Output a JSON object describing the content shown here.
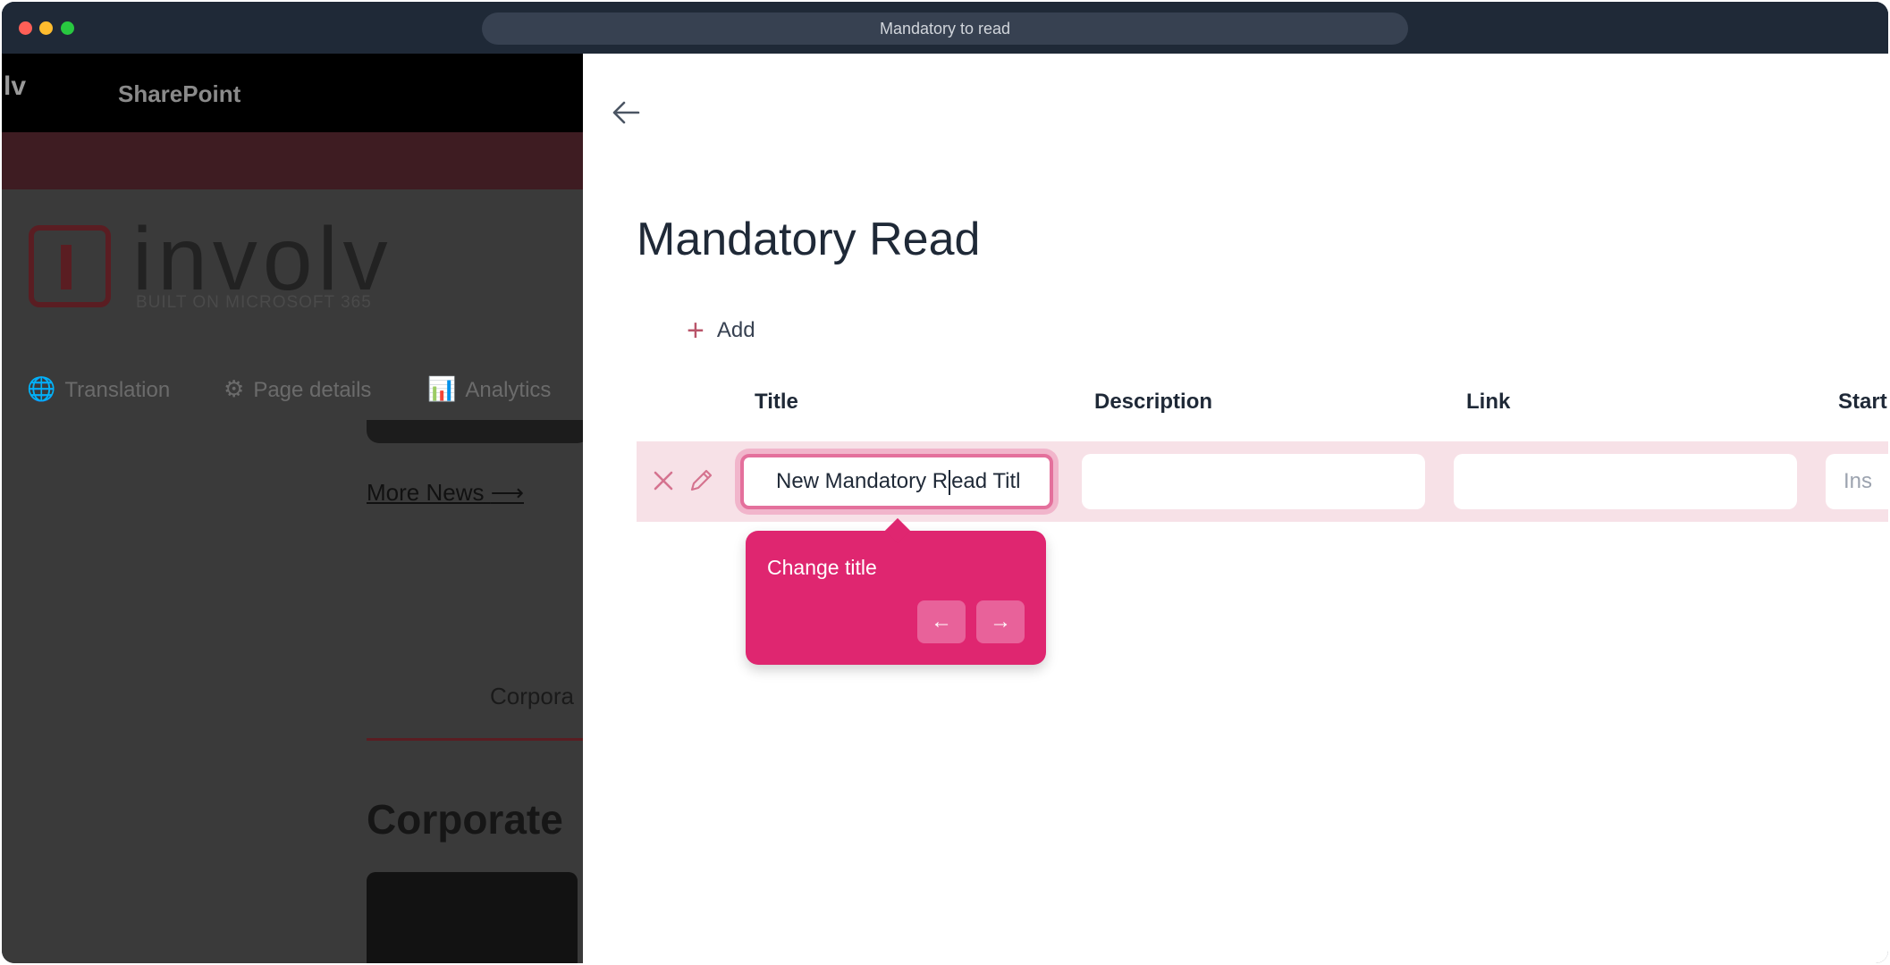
{
  "window": {
    "url_title": "Mandatory to read"
  },
  "background_page": {
    "brand_fragment": "lv",
    "sharepoint_label": "SharePoint",
    "logo_word": "involv",
    "logo_subtitle": "BUILT ON MICROSOFT 365",
    "command_bar": [
      {
        "label": "Translation",
        "icon": "translate-icon"
      },
      {
        "label": "Page details",
        "icon": "gear-icon"
      },
      {
        "label": "Analytics",
        "icon": "analytics-icon"
      }
    ],
    "more_news": "More News",
    "corporate_tab": "Corpora",
    "corporate_heading": "Corporate"
  },
  "panel": {
    "title": "Mandatory Read",
    "add_label": "Add",
    "columns": [
      "Title",
      "Description",
      "Link",
      "Start"
    ],
    "row": {
      "title_before_caret": "New Mandatory R",
      "title_after_caret": "ead Titl",
      "description": "",
      "link": "",
      "start_placeholder": "Ins"
    },
    "tooltip": {
      "text": "Change title"
    }
  },
  "colors": {
    "accent": "#df2670",
    "row_highlight": "#f7e1e7",
    "titlebar": "#1f2937"
  }
}
